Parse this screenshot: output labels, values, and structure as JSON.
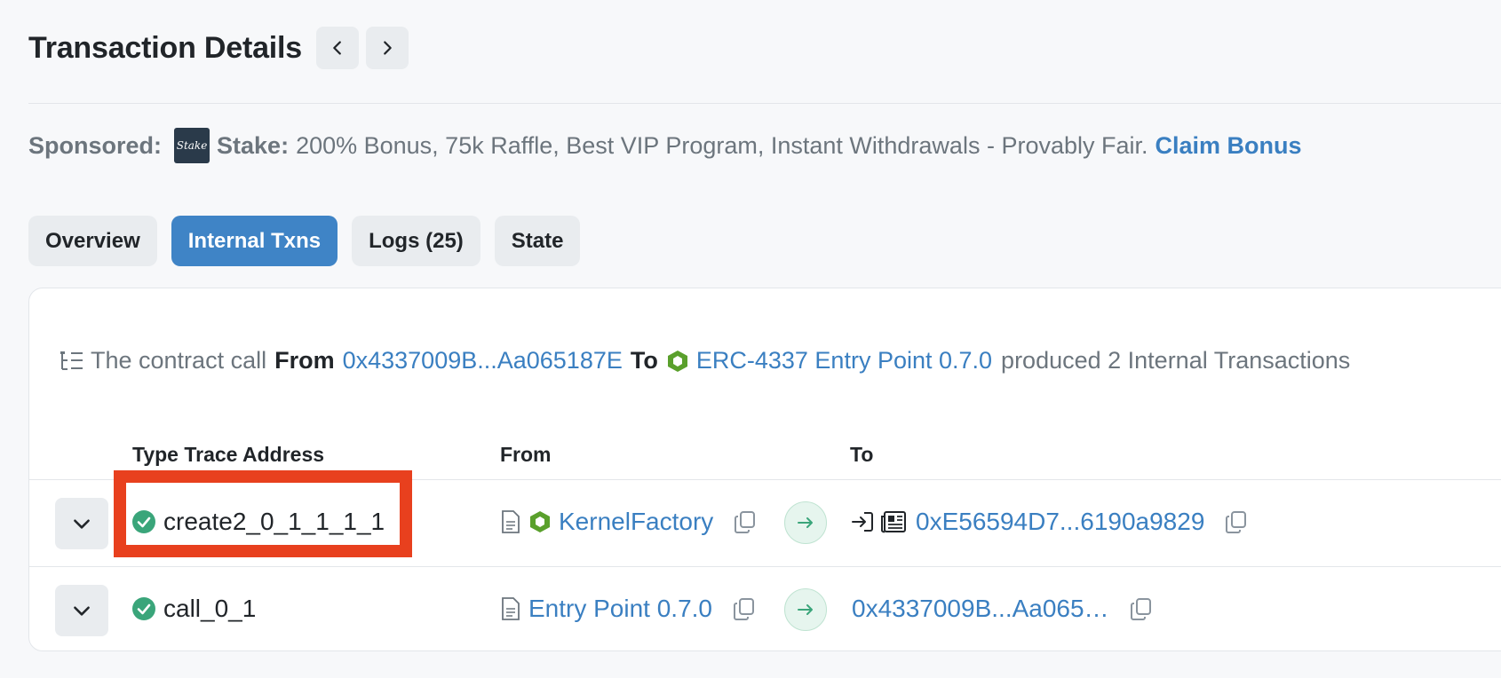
{
  "header": {
    "title": "Transaction Details",
    "prev_icon": "chevron-left-icon",
    "next_icon": "chevron-right-icon"
  },
  "sponsored": {
    "label": "Sponsored:",
    "logo_text": "Stake",
    "brand": "Stake:",
    "text": "200% Bonus, 75k Raffle, Best VIP Program, Instant Withdrawals - Provably Fair.",
    "cta": "Claim Bonus"
  },
  "tabs": [
    {
      "label": "Overview",
      "active": false
    },
    {
      "label": "Internal Txns",
      "active": true
    },
    {
      "label": "Logs (25)",
      "active": false
    },
    {
      "label": "State",
      "active": false
    }
  ],
  "summary": {
    "prefix": "The contract call",
    "from_label": "From",
    "from_address": "0x4337009B...Aa065187E",
    "to_label": "To",
    "to_name": "ERC-4337 Entry Point 0.7.0",
    "suffix": "produced 2 Internal Transactions"
  },
  "table": {
    "headers": {
      "type": "Type Trace Address",
      "from": "From",
      "to": "To"
    },
    "rows": [
      {
        "type": "create2_0_1_1_1_1",
        "status": "success",
        "from": "KernelFactory",
        "to": "0xE56594D7...6190a9829"
      },
      {
        "type": "call_0_1",
        "status": "success",
        "from": "Entry Point 0.7.0",
        "to": "0x4337009B...Aa065…"
      }
    ]
  },
  "colors": {
    "accent": "#3f84c6",
    "link": "#3a7fc1",
    "success": "#3aa57a",
    "highlight": "#e8401e",
    "contract_green": "#5aa02c"
  }
}
